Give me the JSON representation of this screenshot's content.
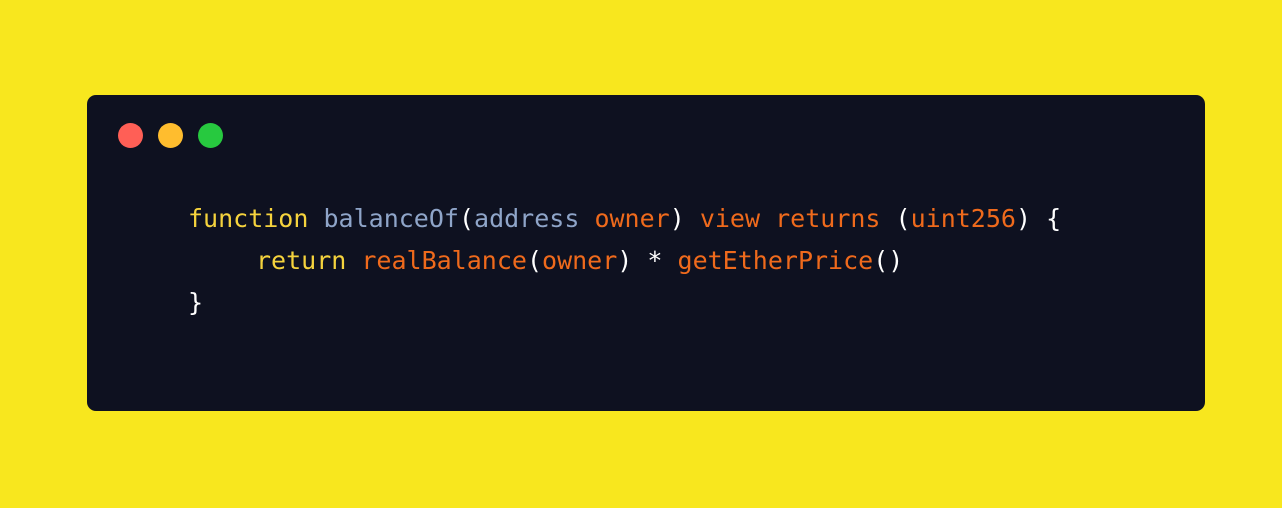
{
  "colors": {
    "background": "#f8e71e",
    "window": "#0e1120",
    "dot_close": "#ff5f56",
    "dot_minimize": "#ffbd2e",
    "dot_maximize": "#27c93f",
    "keyword": "#f5d33d",
    "function_name": "#8fa5c9",
    "identifier": "#ef6a1c",
    "punctuation": "#ffffff"
  },
  "window_controls": [
    "close",
    "minimize",
    "maximize"
  ],
  "code": {
    "line1": {
      "kw_function": "function",
      "fn_name": "balanceOf",
      "p1": "(",
      "type_address": "address",
      "param_owner": "owner",
      "p2": ")",
      "kw_view": "view",
      "kw_returns": "returns",
      "p3": "(",
      "type_uint": "uint256",
      "p4": ")",
      "brace_open": "{"
    },
    "line2": {
      "kw_return": "return",
      "call_real": "realBalance",
      "p1": "(",
      "arg_owner": "owner",
      "p2": ")",
      "op_mul": "*",
      "call_price": "getEtherPrice",
      "p3": "()"
    },
    "line3": {
      "brace_close": "}"
    }
  }
}
